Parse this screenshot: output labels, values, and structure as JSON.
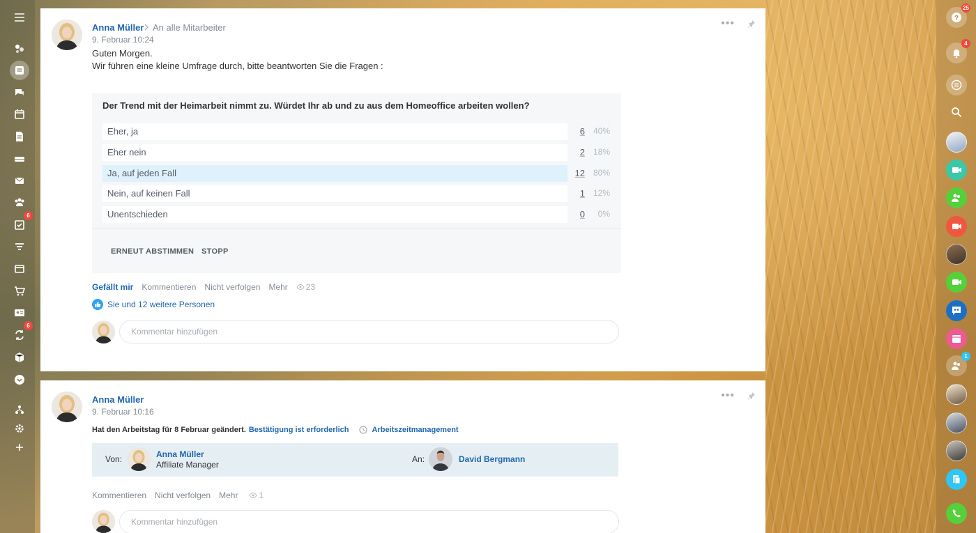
{
  "left_sidebar": {
    "items": [
      {
        "icon": "menu-icon"
      },
      {
        "icon": "feed-icon"
      },
      {
        "icon": "tasks-news-icon",
        "active": true
      },
      {
        "icon": "chat-icon"
      },
      {
        "icon": "calendar-icon"
      },
      {
        "icon": "document-icon"
      },
      {
        "icon": "drive-icon"
      },
      {
        "icon": "mail-icon"
      },
      {
        "icon": "groups-icon"
      },
      {
        "icon": "tasks-icon",
        "badge": "6"
      },
      {
        "icon": "crm-icon"
      },
      {
        "icon": "sites-icon"
      },
      {
        "icon": "shop-icon"
      },
      {
        "icon": "contact-card-icon"
      },
      {
        "icon": "automation-icon",
        "badge": "6"
      },
      {
        "icon": "box-icon"
      },
      {
        "icon": "more-icon"
      },
      {
        "icon": "structure-icon"
      },
      {
        "icon": "settings-icon"
      },
      {
        "icon": "add-icon"
      }
    ]
  },
  "right_sidebar": {
    "help_badge": "25",
    "notifications_badge": "4",
    "group_badge": "1"
  },
  "post1": {
    "author": "Anna Müller",
    "destination": "An alle Mitarbeiter",
    "date": "9. Februar 10:24",
    "text_line1": "Guten Morgen.",
    "text_line2": "Wir führen eine kleine Umfrage durch, bitte beantworten Sie die Fragen :",
    "poll": {
      "question": "Der Trend mit der Heimarbeit nimmt zu. Würdet Ihr ab und zu aus dem Homeoffice arbeiten wollen?",
      "options": [
        {
          "label": "Eher, ja",
          "count": "6",
          "percent": "40%"
        },
        {
          "label": "Eher nein",
          "count": "2",
          "percent": "18%"
        },
        {
          "label": "Ja, auf jeden Fall",
          "count": "12",
          "percent": "80%",
          "selected": true
        },
        {
          "label": "Nein, auf keinen Fall",
          "count": "1",
          "percent": "12%"
        },
        {
          "label": "Unentschieden",
          "count": "0",
          "percent": "0%"
        }
      ],
      "revote_label": "ERNEUT ABSTIMMEN",
      "stop_label": "STOPP"
    },
    "actions": {
      "like": "Gefällt mir",
      "comment": "Kommentieren",
      "unfollow": "Nicht verfolgen",
      "more": "Mehr",
      "views": "23"
    },
    "likers": "Sie und 12 weitere Personen",
    "comment_placeholder": "Kommentar hinzufügen"
  },
  "post2": {
    "author": "Anna Müller",
    "date": "9. Februar 10:16",
    "changed_text": "Hat den Arbeitstag für 8 Februar geändert.",
    "confirm_link": "Bestätigung ist erforderlich",
    "module_link": "Arbeitszeitmanagement",
    "from_label": "Von:",
    "from_name": "Anna Müller",
    "from_role": "Affiliate Manager",
    "to_label": "An:",
    "to_name": "David Bergmann",
    "actions": {
      "comment": "Kommentieren",
      "unfollow": "Nicht verfolgen",
      "more": "Mehr",
      "views": "1"
    },
    "comment_placeholder": "Kommentar hinzufügen"
  },
  "colors": {
    "link": "#2067b0",
    "selected_option": "#dff1fb",
    "badge": "#f0483e"
  }
}
